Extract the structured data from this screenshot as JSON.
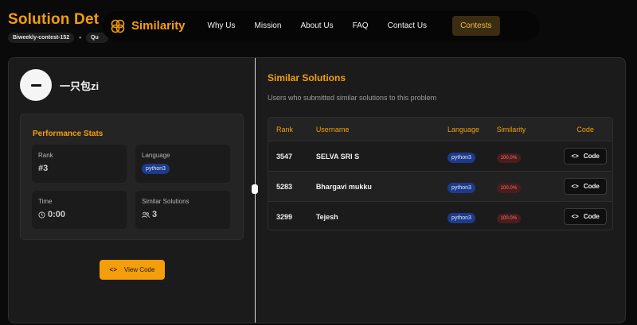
{
  "page": {
    "title": "Solution Det",
    "breadcrumb": [
      "Biweekly-contest-152",
      "Qu"
    ]
  },
  "nav": {
    "brand": "Similarity",
    "links": [
      "Why Us",
      "Mission",
      "About Us",
      "FAQ",
      "Contact Us"
    ],
    "cta": "Contests"
  },
  "user": {
    "name": "一只包zi"
  },
  "stats": {
    "title": "Performance Stats",
    "rank_label": "Rank",
    "rank_value": "#3",
    "language_label": "Language",
    "language_value": "python3",
    "time_label": "Time",
    "time_value": "0:00",
    "similar_label": "Similar Solutions",
    "similar_value": "3"
  },
  "view_code_label": "View Code",
  "similar": {
    "title": "Similar Solutions",
    "subtitle": "Users who submitted similar solutions to this problem",
    "columns": [
      "Rank",
      "Username",
      "Language",
      "Similarity",
      "Code"
    ],
    "rows": [
      {
        "rank": "3547",
        "username": "SELVA SRI S",
        "language": "python3",
        "similarity": "100.0%",
        "code": "Code"
      },
      {
        "rank": "5283",
        "username": "Bhargavi mukku",
        "language": "python3",
        "similarity": "100.0%",
        "code": "Code"
      },
      {
        "rank": "3299",
        "username": "Tejesh",
        "language": "python3",
        "similarity": "100.0%",
        "code": "Code"
      }
    ]
  },
  "colors": {
    "accent": "#f59e0b",
    "background": "#0a0a0a",
    "panel": "#1b1b1b",
    "language_badge": "#1e3a8a",
    "similarity_badge": "#4a1d1d"
  }
}
